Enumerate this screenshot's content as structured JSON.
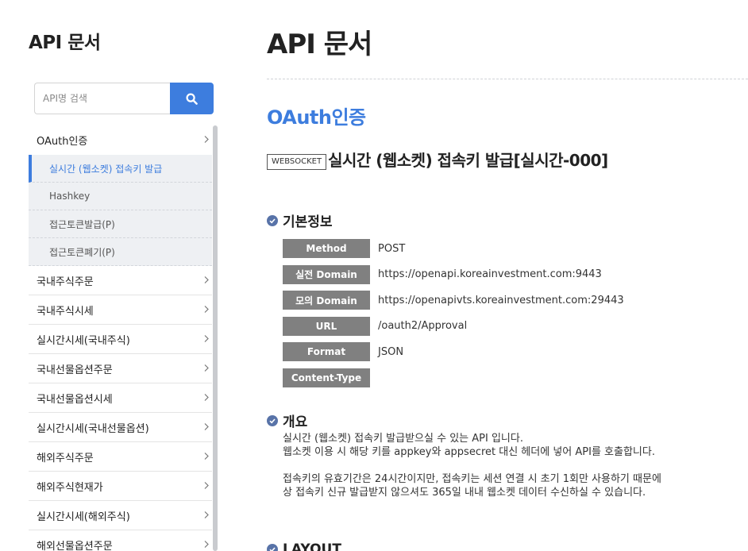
{
  "sidebar": {
    "title": "API 문서",
    "search": {
      "placeholder": "API명 검색",
      "icon": "search-icon"
    },
    "menu": [
      {
        "label": "OAuth인증",
        "expanded": true,
        "children": [
          {
            "label": "실시간 (웹소켓) 접속키 발급",
            "active": true
          },
          {
            "label": "Hashkey"
          },
          {
            "label": "접근토큰발급(P)"
          },
          {
            "label": "접근토큰폐기(P)"
          }
        ]
      },
      {
        "label": "국내주식주문"
      },
      {
        "label": "국내주식시세"
      },
      {
        "label": "실시간시세(국내주식)"
      },
      {
        "label": "국내선물옵션주문"
      },
      {
        "label": "국내선물옵션시세"
      },
      {
        "label": "실시간시세(국내선물옵션)"
      },
      {
        "label": "해외주식주문"
      },
      {
        "label": "해외주식현재가"
      },
      {
        "label": "실시간시세(해외주식)"
      },
      {
        "label": "해외선물옵션주문"
      }
    ]
  },
  "main": {
    "page_title": "API 문서",
    "section_title": "OAuth인증",
    "api": {
      "badge": "WEBSOCKET",
      "name": "실시간 (웹소켓) 접속키 발급[실시간-000]"
    },
    "basic_info": {
      "heading": "기본정보",
      "rows": [
        {
          "key": "Method",
          "value": "POST"
        },
        {
          "key": "실전 Domain",
          "value": "https://openapi.koreainvestment.com:9443"
        },
        {
          "key": "모의 Domain",
          "value": "https://openapivts.koreainvestment.com:29443"
        },
        {
          "key": "URL",
          "value": "/oauth2/Approval"
        },
        {
          "key": "Format",
          "value": "JSON"
        },
        {
          "key": "Content-Type",
          "value": ""
        }
      ]
    },
    "overview": {
      "heading": "개요",
      "lines": [
        "실시간 (웹소켓) 접속키 발급받으실 수 있는 API 입니다.",
        "웹소켓 이용 시 해당 키를 appkey와 appsecret 대신 헤더에 넣어 API를 호출합니다.",
        "",
        "접속키의 유효기간은 24시간이지만, 접속키는 세션 연결 시 초기 1회만 사용하기 때문에",
        "상 접속키 신규 발급받지 않으셔도 365일 내내 웹소켓 데이터 수신하실 수 있습니다."
      ]
    },
    "layout_heading": "LAYOUT"
  },
  "colors": {
    "accent": "#3d7dde",
    "key_bg": "#808080",
    "bullet": "#5873a8"
  }
}
